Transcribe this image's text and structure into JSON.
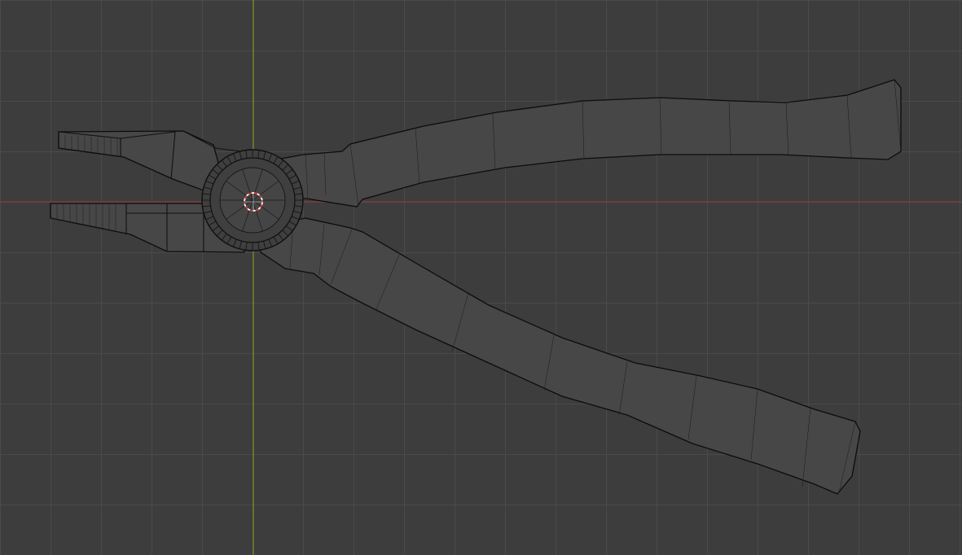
{
  "viewport": {
    "name": "3D Viewport",
    "mode": "wireframe",
    "object": "pliers",
    "colors": {
      "background": "#3d3d3d",
      "grid": "#4a4a4a",
      "x_axis": "#8a3a3a",
      "y_axis": "#6f8a2a",
      "wire": "#111111",
      "origin": "#d04040"
    },
    "origin_icon": "3d-cursor-icon"
  }
}
